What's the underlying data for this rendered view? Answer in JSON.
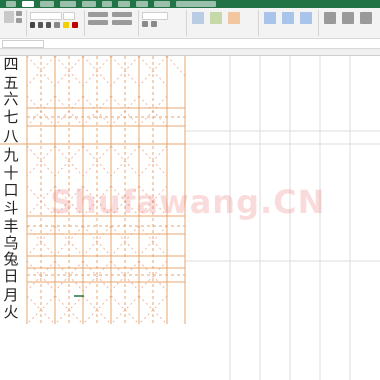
{
  "app": {
    "window": "Microsoft Excel",
    "colors": {
      "ribbon_tab_bar": "#217346",
      "ribbon": "#f3f3f3",
      "grid_major": "#e8b07a",
      "grid_dotted": "#f0b9a6",
      "sheet_grid": "#d4d4d4"
    }
  },
  "characters": [
    "四",
    "五",
    "六",
    "七",
    "八",
    "九",
    "十",
    "口",
    "斗",
    "丰",
    "乌",
    "兔",
    "日",
    "月",
    "火"
  ],
  "watermark": "Shufawang.CN"
}
